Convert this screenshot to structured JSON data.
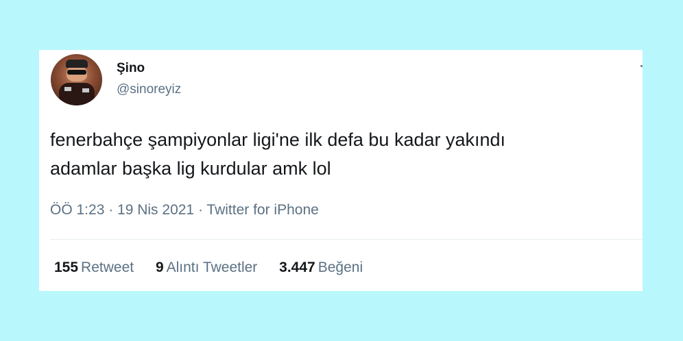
{
  "user": {
    "display_name": "Şino",
    "handle": "@sinoreyiz"
  },
  "tweet": {
    "line1": "fenerbahçe şampiyonlar ligi'ne ilk defa bu kadar yakındı",
    "line2": "adamlar başka lig kurdular amk lol",
    "meta": "ÖÖ 1:23 · 19 Nis 2021 · Twitter for iPhone"
  },
  "stats": {
    "retweets": {
      "count": "155",
      "label": "Retweet"
    },
    "quotes": {
      "count": "9",
      "label": "Alıntı Tweetler"
    },
    "likes": {
      "count": "3.447",
      "label": "Beğeni"
    }
  },
  "colors": {
    "background": "#b8f8fc",
    "card": "#ffffff",
    "text": "#14171a",
    "secondary": "#5b7083"
  }
}
